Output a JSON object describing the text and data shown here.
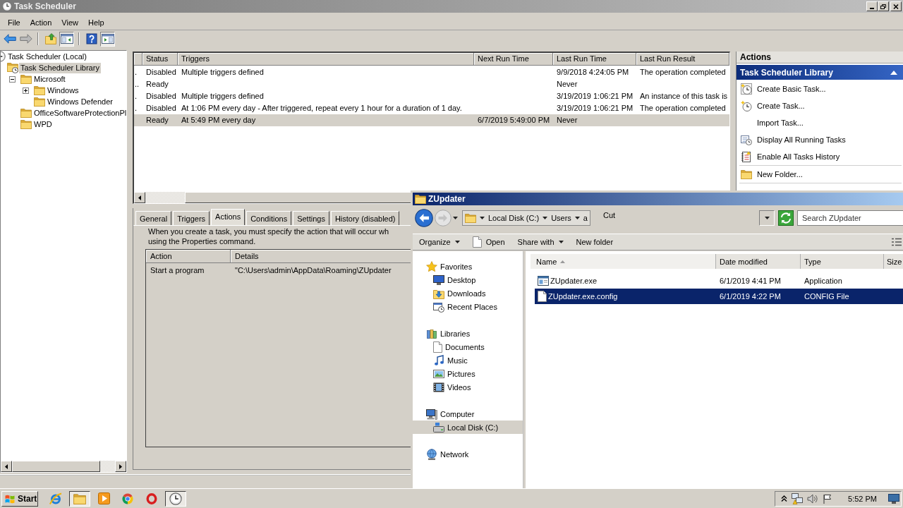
{
  "task_scheduler": {
    "title": "Task Scheduler",
    "active": false,
    "menu": [
      "File",
      "Action",
      "View",
      "Help"
    ],
    "toolbar": [
      [
        {
          "kind": "back",
          "pressed": false
        },
        {
          "kind": "forward",
          "pressed": false
        }
      ],
      [
        {
          "kind": "parent",
          "pressed": false
        },
        {
          "kind": "console_tree",
          "pressed": true
        }
      ],
      [
        {
          "kind": "help",
          "pressed": false
        },
        {
          "kind": "action_pane",
          "pressed": true
        }
      ]
    ],
    "tree": [
      {
        "label": "Task Scheduler (Local)",
        "selected": false,
        "children": [
          {
            "label": "Task Scheduler Library",
            "selected": true,
            "children": [
              {
                "label": "Microsoft",
                "selected": false,
                "expanded": true,
                "children": [
                  {
                    "label": "Windows",
                    "selected": false,
                    "expanded": false
                  },
                  {
                    "label": "Windows Defender",
                    "selected": false
                  }
                ]
              },
              {
                "label": "OfficeSoftwareProtectionPl",
                "selected": false
              },
              {
                "label": "WPD",
                "selected": false
              }
            ]
          }
        ]
      }
    ],
    "task_table": {
      "columns": [
        "Status",
        "Triggers",
        "Next Run Time",
        "Last Run Time",
        "Last Run Result"
      ],
      "rows": [
        {
          "column_1": ".",
          "status": "Disabled",
          "triggers": "Multiple triggers defined",
          "last_run_time": "9/9/2018 4:24:05 PM",
          "last_run_result": "The operation completed",
          "selected": false
        },
        {
          "column_1": "..",
          "status": "Ready",
          "last_run_time": "Never",
          "selected": false
        },
        {
          "column_1": ".",
          "status": "Disabled",
          "triggers": "Multiple triggers defined",
          "last_run_time": "3/19/2019 1:06:21 PM",
          "last_run_result": "An instance of this task is",
          "selected": false
        },
        {
          "column_1": ".",
          "status": "Disabled",
          "triggers": "At 1:06 PM every day - After triggered, repeat every 1 hour for a duration of 1 day.",
          "last_run_time": "3/19/2019 1:06:21 PM",
          "last_run_result": "The operation completed",
          "selected": false
        },
        {
          "status": "Ready",
          "triggers": "At 5:49 PM every day",
          "next_run_time": "6/7/2019 5:49:00 PM",
          "last_run_time": "Never",
          "selected": true
        }
      ]
    },
    "details": {
      "tabs": [
        {
          "label": "General",
          "selected": false
        },
        {
          "label": "Triggers",
          "selected": false
        },
        {
          "label": "Actions",
          "selected": true
        },
        {
          "label": "Conditions",
          "selected": false
        },
        {
          "label": "Settings",
          "selected": false
        },
        {
          "label": "History (disabled)",
          "selected": false
        }
      ],
      "description": [
        "When you create a task, you must specify the action that will occur wh",
        "using the Properties command."
      ],
      "actions_table": {
        "columns": [
          "Action",
          "Details"
        ],
        "rows": [
          {
            "action": "Start a program",
            "details": "\"C:\\Users\\admin\\AppData\\Roaming\\ZUpdater"
          }
        ]
      }
    },
    "actions_pane": {
      "title": "Actions",
      "section": "Task Scheduler Library",
      "expanded": true,
      "groups": [
        [
          "Create Basic Task...",
          "Create Task...",
          "Import Task...",
          "Display All Running Tasks",
          "Enable All Tasks History"
        ],
        [
          "New Folder..."
        ]
      ]
    }
  },
  "explorer": {
    "title": "ZUpdater",
    "active": true,
    "history_buttons": [
      {
        "disabled": false
      },
      {
        "disabled": true
      }
    ],
    "breadcrumb": [
      "Local Disk (C:)",
      "Users",
      "a"
    ],
    "floating_text": "Cut",
    "search": {
      "placeholder": "Search ZUpdater"
    },
    "commands": [
      {
        "kind": "menu",
        "label": "Organize"
      },
      {
        "kind": "file",
        "label": "Open"
      },
      {
        "kind": "menu",
        "label": "Share with"
      },
      {
        "kind": "plain",
        "label": "New folder"
      }
    ],
    "nav": [
      {
        "label": "Favorites",
        "selected": false,
        "children": [
          {
            "label": "Desktop",
            "selected": false
          },
          {
            "label": "Downloads",
            "selected": false
          },
          {
            "label": "Recent Places",
            "selected": false
          }
        ]
      },
      {
        "label": "Libraries",
        "selected": false,
        "children": [
          {
            "label": "Documents",
            "selected": false
          },
          {
            "label": "Music",
            "selected": false
          },
          {
            "label": "Pictures",
            "selected": false
          },
          {
            "label": "Videos",
            "selected": false
          }
        ]
      },
      {
        "label": "Computer",
        "selected": false,
        "children": [
          {
            "label": "Local Disk (C:)",
            "selected": true
          }
        ]
      },
      {
        "label": "Network",
        "selected": false
      }
    ],
    "files": {
      "columns": [
        {
          "label": "Name",
          "sorted": true
        },
        {
          "label": "Date modified",
          "sorted": false
        },
        {
          "label": "Type",
          "sorted": false
        },
        {
          "label": "Size",
          "sorted": false
        }
      ],
      "rows": [
        {
          "name": "ZUpdater.exe",
          "date_modified": "6/1/2019 4:41 PM",
          "type": "Application",
          "selected": false
        },
        {
          "name": "ZUpdater.exe.config",
          "date_modified": "6/1/2019 4:22 PM",
          "type": "CONFIG File",
          "selected": true
        }
      ]
    }
  },
  "taskbar": {
    "start": "Start",
    "apps": [
      {
        "active": false
      },
      {
        "active": true
      },
      {
        "active": false
      },
      {
        "active": false
      },
      {
        "active": false
      },
      {
        "active": true
      }
    ],
    "clock": "5:52 PM"
  }
}
